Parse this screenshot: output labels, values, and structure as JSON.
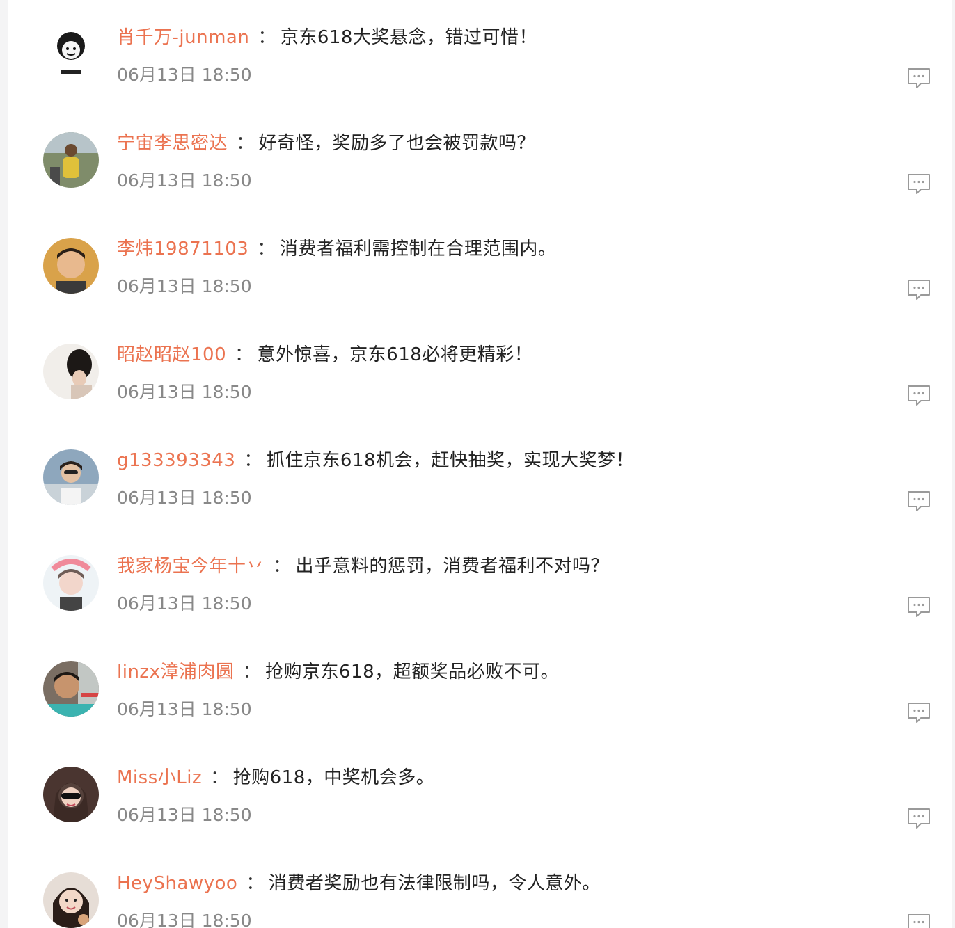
{
  "comments": [
    {
      "user": "肖千万-junman",
      "sep": "：",
      "text": "京东618大奖悬念，错过可惜！",
      "time": "06月13日 18:50"
    },
    {
      "user": "宁宙李思密达",
      "sep": "：",
      "text": "好奇怪，奖励多了也会被罚款吗？",
      "time": "06月13日 18:50"
    },
    {
      "user": "李炜19871103",
      "sep": "：",
      "text": "消费者福利需控制在合理范围内。",
      "time": "06月13日 18:50"
    },
    {
      "user": "昭赵昭赵100",
      "sep": "：",
      "text": "意外惊喜，京东618必将更精彩！",
      "time": "06月13日 18:50"
    },
    {
      "user": "g133393343",
      "sep": "：",
      "text": "抓住京东618机会，赶快抽奖，实现大奖梦！",
      "time": "06月13日 18:50"
    },
    {
      "user": "我家杨宝今年十丷",
      "sep": "：",
      "text": "出乎意料的惩罚，消费者福利不对吗？",
      "time": "06月13日 18:50"
    },
    {
      "user": "linzx漳浦肉圆",
      "sep": "：",
      "text": "抢购京东618，超额奖品必败不可。",
      "time": "06月13日 18:50"
    },
    {
      "user": "Miss小Liz",
      "sep": "：",
      "text": "抢购618，中奖机会多。",
      "time": "06月13日 18:50"
    },
    {
      "user": "HeyShawyoo",
      "sep": "：",
      "text": "消费者奖励也有法律限制吗，令人意外。",
      "time": "06月13日 18:50"
    }
  ],
  "colors": {
    "username": "#eb7350",
    "text": "#222222",
    "time": "#888888",
    "icon": "#9a9a9a"
  },
  "icons": {
    "reply": "comment-bubble-icon"
  }
}
